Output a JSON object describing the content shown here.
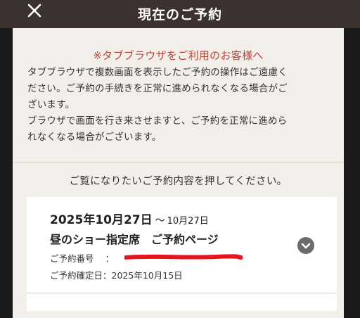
{
  "header": {
    "title": "現在のご予約",
    "close_icon": "close-icon"
  },
  "notice": {
    "title": "※タブブラウザをご利用のお客様へ",
    "paragraph1_line1": "タブブラウザで複数画面を表示したご予約の操作はご遠慮く",
    "paragraph1_line2": "ださい。ご予約の手続きを正常に進められなくなる場合がご",
    "paragraph1_line3": "ざいます。",
    "paragraph2_line1": "ブラウザで画面を行き来させますと、ご予約を正常に進めら",
    "paragraph2_line2": "れなくなる場合がございます。"
  },
  "prompt": "ご覧になりたいご予約内容を押してください。",
  "reservation": {
    "date_start": "2025年10月27日",
    "date_separator": "〜",
    "date_end": "10月27日",
    "title": "昼のショー指定席　ご予約ページ",
    "number_label": "ご予約番号",
    "number_separator": "：",
    "confirm_label": "ご予約確定日",
    "confirm_separator": "：",
    "confirm_date": "2025年10月15日",
    "expand_icon": "chevron-down-icon"
  },
  "colors": {
    "header_bg": "#3b3230",
    "panel_bg": "#f2eee9",
    "notice_title": "#b5473a",
    "redaction": "#e8141c",
    "chevron_bg": "#6b6b6b"
  }
}
